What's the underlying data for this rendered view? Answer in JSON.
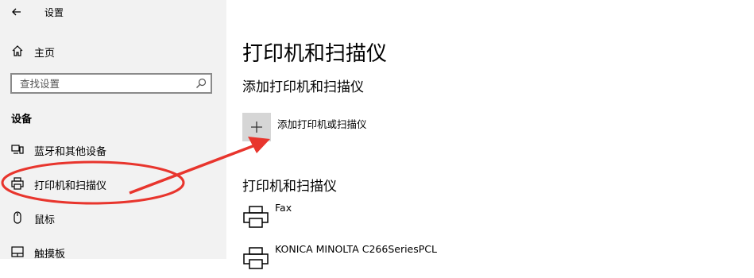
{
  "window": {
    "title": "设置"
  },
  "sidebar": {
    "home_label": "主页",
    "search_placeholder": "查找设置",
    "section_title": "设备",
    "items": [
      {
        "label": "蓝牙和其他设备",
        "icon": "devices-icon"
      },
      {
        "label": "打印机和扫描仪",
        "icon": "printer-icon"
      },
      {
        "label": "鼠标",
        "icon": "mouse-icon"
      },
      {
        "label": "触摸板",
        "icon": "touchpad-icon"
      }
    ]
  },
  "main": {
    "title": "打印机和扫描仪",
    "add_heading": "添加打印机和扫描仪",
    "add_button_label": "添加打印机或扫描仪",
    "list_heading": "打印机和扫描仪",
    "printers": [
      {
        "name": "Fax"
      },
      {
        "name": "KONICA MINOLTA C266SeriesPCL"
      }
    ]
  },
  "annotation": {
    "color": "#e8352d"
  }
}
